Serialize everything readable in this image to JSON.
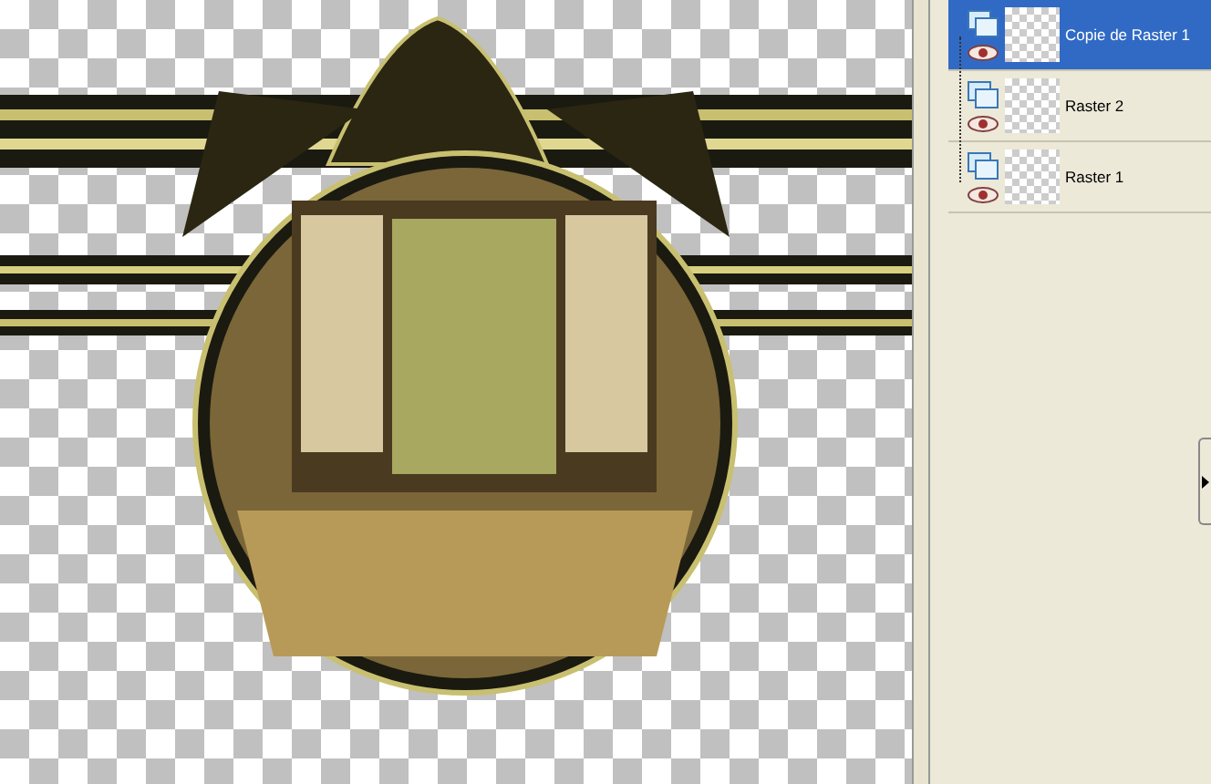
{
  "layers": [
    {
      "name": "Copie de Raster 1",
      "selected": true,
      "visible": true
    },
    {
      "name": "Raster 2",
      "selected": false,
      "visible": true
    },
    {
      "name": "Raster 1",
      "selected": false,
      "visible": true
    }
  ]
}
